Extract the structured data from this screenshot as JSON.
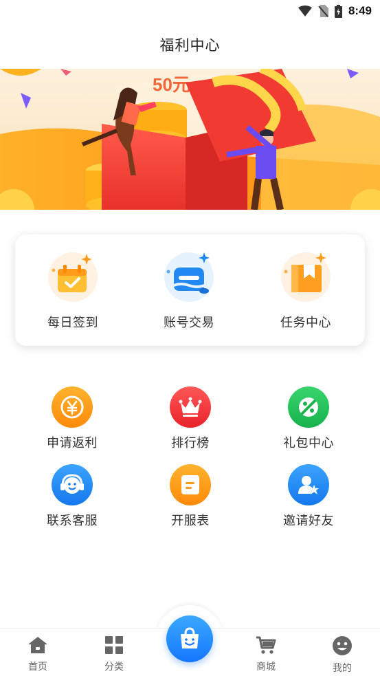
{
  "status_bar": {
    "time": "8:49",
    "icons": [
      "wifi-icon",
      "no-sim-icon",
      "battery-charging-icon"
    ]
  },
  "header": {
    "title": "福利中心"
  },
  "banner": {
    "text": "50元",
    "icon": "gift-box-illustration"
  },
  "feature_card": {
    "items": [
      {
        "label": "每日签到",
        "icon": "calendar-check-icon"
      },
      {
        "label": "账号交易",
        "icon": "account-trade-icon"
      },
      {
        "label": "任务中心",
        "icon": "task-bookmark-icon"
      }
    ]
  },
  "grid": {
    "items": [
      {
        "label": "申请返利",
        "icon": "yen-coin-icon",
        "color": "#ff9a1a"
      },
      {
        "label": "排行榜",
        "icon": "crown-icon",
        "color": "#f0373a"
      },
      {
        "label": "礼包中心",
        "icon": "gift-tag-icon",
        "color": "#22c25a"
      },
      {
        "label": "联系客服",
        "icon": "headset-icon",
        "color": "#1a86f5"
      },
      {
        "label": "开服表",
        "icon": "list-sheet-icon",
        "color": "#ff9a1a"
      },
      {
        "label": "邀请好友",
        "icon": "user-star-icon",
        "color": "#1a86f5"
      }
    ]
  },
  "tab_bar": {
    "items": [
      {
        "label": "首页",
        "icon": "home-icon"
      },
      {
        "label": "分类",
        "icon": "category-grid-icon"
      },
      {
        "label": "",
        "icon": "shopping-bag-icon"
      },
      {
        "label": "商城",
        "icon": "cart-icon"
      },
      {
        "label": "我的",
        "icon": "smiley-icon"
      }
    ]
  }
}
